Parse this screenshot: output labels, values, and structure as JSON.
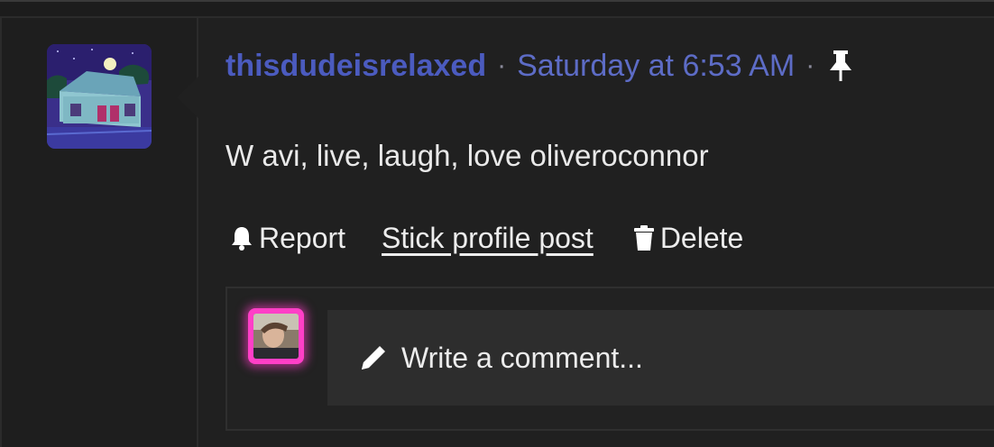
{
  "post": {
    "username": "thisdudeisrelaxed",
    "separator": "·",
    "timestamp": "Saturday at 6:53 AM",
    "pin_icon": "pin-icon",
    "message": "W avi, live, laugh, love oliveroconnor"
  },
  "actions": {
    "report_label": "Report",
    "report_icon": "bell-icon",
    "stick_label": "Stick profile post",
    "delete_label": "Delete",
    "delete_icon": "trash-icon"
  },
  "comment": {
    "placeholder": "Write a comment...",
    "icon": "pencil-icon",
    "avatar_glow_color": "#ff3fc7"
  },
  "colors": {
    "username": "#4b5bbf",
    "timestamp": "#5d6cc6",
    "background": "#202020",
    "text": "#e9e9e9"
  }
}
